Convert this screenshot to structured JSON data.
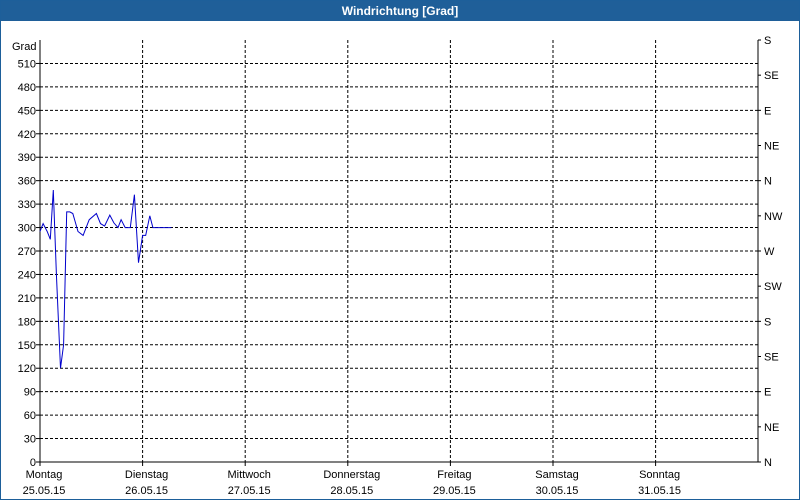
{
  "window": {
    "title": "Windrichtung [Grad]"
  },
  "colors": {
    "titlebar": "#1f5f99",
    "line": "#0000cc",
    "grid": "#000000",
    "background": "#ffffff"
  },
  "chart_data": {
    "type": "line",
    "title": "Windrichtung [Grad]",
    "ylabel": "Grad",
    "ylim": [
      0,
      540
    ],
    "yticks": [
      0,
      30,
      60,
      90,
      120,
      150,
      180,
      210,
      240,
      270,
      300,
      330,
      360,
      390,
      420,
      450,
      480,
      510
    ],
    "right_axis_labels": [
      "N",
      "NE",
      "E",
      "SE",
      "S",
      "SW",
      "W",
      "NW",
      "N",
      "NE",
      "E",
      "SE",
      "S"
    ],
    "x_range_days": [
      0,
      7
    ],
    "x_ticks": [
      {
        "day": "Montag",
        "date": "25.05.15"
      },
      {
        "day": "Dienstag",
        "date": "26.05.15"
      },
      {
        "day": "Mittwoch",
        "date": "27.05.15"
      },
      {
        "day": "Donnerstag",
        "date": "28.05.15"
      },
      {
        "day": "Freitag",
        "date": "29.05.15"
      },
      {
        "day": "Samstag",
        "date": "30.05.15"
      },
      {
        "day": "Sonntag",
        "date": "31.05.15"
      }
    ],
    "grid": true,
    "series": [
      {
        "x": [
          0.0,
          0.03,
          0.07,
          0.1,
          0.13,
          0.16,
          0.2,
          0.23,
          0.26,
          0.29,
          0.32,
          0.37,
          0.42,
          0.48,
          0.55,
          0.59,
          0.63,
          0.68,
          0.72,
          0.76,
          0.79,
          0.83,
          0.88,
          0.92,
          0.96,
          1.0,
          1.03,
          1.07,
          1.1,
          1.13,
          1.16,
          1.2,
          1.23,
          1.26,
          1.28
        ],
        "y": [
          295,
          305,
          295,
          285,
          348,
          240,
          120,
          150,
          320,
          320,
          318,
          295,
          290,
          310,
          318,
          305,
          302,
          316,
          306,
          300,
          310,
          300,
          300,
          342,
          255,
          290,
          290,
          315,
          300,
          300,
          300,
          300,
          300,
          300,
          300
        ]
      }
    ]
  }
}
